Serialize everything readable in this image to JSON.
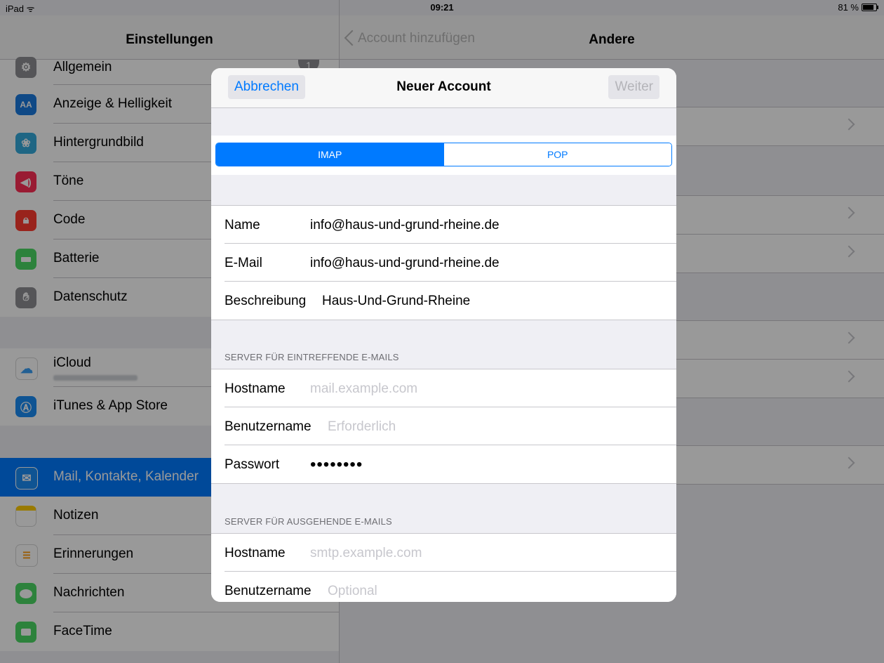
{
  "status_bar": {
    "device": "iPad",
    "time": "09:21",
    "battery": "81 %",
    "battery_level": 0.81
  },
  "settings": {
    "title": "Einstellungen",
    "badge": "1",
    "group1": [
      {
        "label": "Allgemein",
        "icon": "gear-icon",
        "color": "#8e8e93"
      },
      {
        "label": "Anzeige & Helligkeit",
        "icon": "display-icon",
        "color": "#1a7ae0"
      },
      {
        "label": "Hintergrundbild",
        "icon": "wallpaper-icon",
        "color": "#34aadc"
      },
      {
        "label": "Töne",
        "icon": "speaker-icon",
        "color": "#ff2d55"
      },
      {
        "label": "Code",
        "icon": "lock-icon",
        "color": "#ff3b30"
      },
      {
        "label": "Batterie",
        "icon": "battery-icon",
        "color": "#4cd964"
      },
      {
        "label": "Datenschutz",
        "icon": "hand-icon",
        "color": "#8e8e93"
      }
    ],
    "group2": [
      {
        "label": "iCloud",
        "icon": "cloud-icon",
        "color": "#ffffff"
      },
      {
        "label": "iTunes & App Store",
        "icon": "appstore-icon",
        "color": "#1a8cf5"
      }
    ],
    "group3": [
      {
        "label": "Mail, Kontakte, Kalender",
        "icon": "mail-icon",
        "color": "#1a8cf5",
        "selected": true
      },
      {
        "label": "Notizen",
        "icon": "notes-icon",
        "color": "#ffcc00"
      },
      {
        "label": "Erinnerungen",
        "icon": "reminders-icon",
        "color": "#ffffff"
      },
      {
        "label": "Nachrichten",
        "icon": "messages-icon",
        "color": "#4cd964"
      },
      {
        "label": "FaceTime",
        "icon": "facetime-icon",
        "color": "#4cd964"
      }
    ]
  },
  "detail": {
    "back_label": "Account hinzufügen",
    "title": "Andere"
  },
  "modal": {
    "cancel_label": "Abbrechen",
    "title": "Neuer Account",
    "next_label": "Weiter",
    "segments": [
      "IMAP",
      "POP"
    ],
    "selected_segment": "IMAP",
    "account": {
      "name_label": "Name",
      "name_value": "info@haus-und-grund-rheine.de",
      "email_label": "E-Mail",
      "email_value": "info@haus-und-grund-rheine.de",
      "desc_label": "Beschreibung",
      "desc_value": "Haus-Und-Grund-Rheine"
    },
    "incoming": {
      "header": "SERVER FÜR EINTREFFENDE E-MAILS",
      "host_label": "Hostname",
      "host_placeholder": "mail.example.com",
      "user_label": "Benutzername",
      "user_placeholder": "Erforderlich",
      "pass_label": "Passwort",
      "pass_value": "••••••••"
    },
    "outgoing": {
      "header": "SERVER FÜR AUSGEHENDE E-MAILS",
      "host_label": "Hostname",
      "host_placeholder": "smtp.example.com",
      "user_label": "Benutzername",
      "user_placeholder": "Optional"
    }
  }
}
